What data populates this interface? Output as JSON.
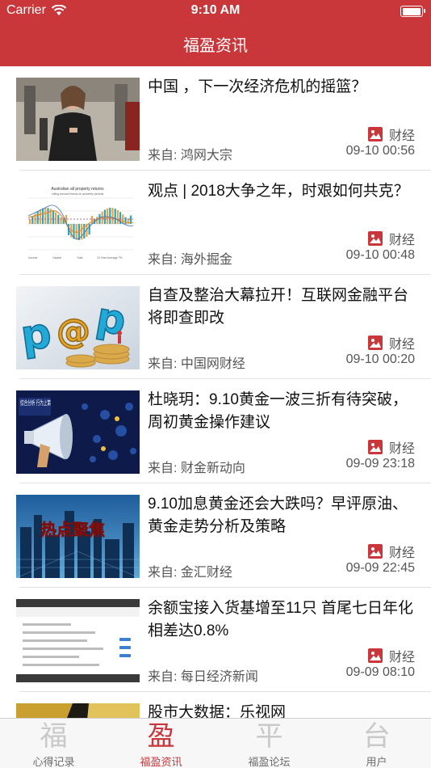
{
  "status_bar": {
    "carrier": "Carrier",
    "time": "9:10 AM"
  },
  "nav": {
    "title": "福盈资讯"
  },
  "articles": [
    {
      "title": "中国 ，下一次经济危机的摇篮？",
      "category": "财经",
      "source": "来自: 鸿网大宗",
      "time": "09-10 00:56",
      "image": "photo-woman-phone"
    },
    {
      "title": "观点 | 2018大争之年，时艰如何共克？",
      "category": "财经",
      "source": "来自: 海外掘金",
      "time": "09-10 00:48",
      "image": "chart-property-returns",
      "image_text": {
        "heading": "Australian all property returns",
        "subheading": "rolling annual returns on quarterly periods",
        "legend": [
          "Income",
          "Capital",
          "Total",
          "10 Year Average 7%"
        ]
      }
    },
    {
      "title": "自查及整治大幕拉开！互联网金融平台将即查即改",
      "category": "财经",
      "source": "来自: 中国网财经",
      "time": "09-10 00:20",
      "image": "p2p-letters"
    },
    {
      "title": "杜晓玥：9.10黄金一波三折有待突破，周初黄金操作建议",
      "category": "财经",
      "source": "来自: 财金新动向",
      "time": "09-09 23:18",
      "image": "megaphone",
      "image_text": {
        "badge": "综合分析 行为上策"
      }
    },
    {
      "title": "9.10加息黄金还会大跌吗？早评原油、黄金走势分析及策略",
      "category": "财经",
      "source": "来自: 金汇财经",
      "time": "09-09 22:45",
      "image": "city-hotspot",
      "image_text": {
        "banner": "热点聚焦"
      }
    },
    {
      "title": "余额宝接入货基增至11只 首尾七日年化相差达0.8%",
      "category": "财经",
      "source": "来自: 每日经济新闻",
      "time": "09-09 08:10",
      "image": "app-screenshot"
    },
    {
      "title": "股市大数据：乐视网",
      "category": "",
      "source": "",
      "time": "",
      "image": "gold-stripe"
    }
  ],
  "tabbar": [
    {
      "glyph": "福",
      "label": "心得记录",
      "active": false
    },
    {
      "glyph": "盈",
      "label": "福盈资讯",
      "active": true
    },
    {
      "glyph": "平",
      "label": "福盈论坛",
      "active": false
    },
    {
      "glyph": "台",
      "label": "用户",
      "active": false
    }
  ],
  "colors": {
    "accent": "#c9373b",
    "text": "#111111",
    "meta": "#555555",
    "tab_inactive": "#c9c9c9"
  }
}
